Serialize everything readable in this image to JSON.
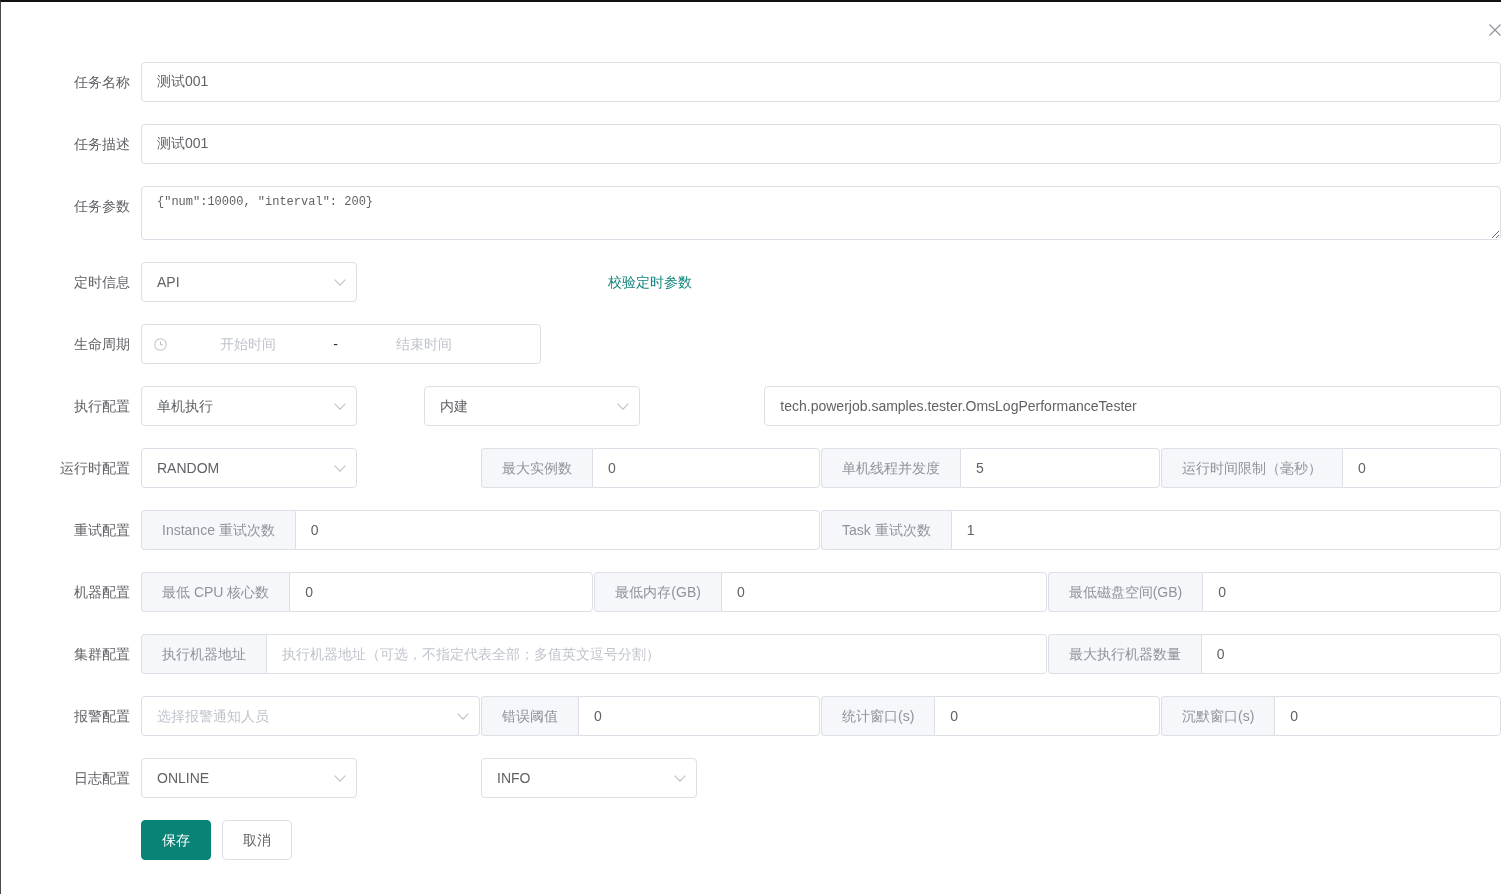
{
  "dialog": {
    "form": {
      "rows": [
        {
          "label": "任务名称",
          "controls": [
            {
              "kind": "input",
              "value": "测试001"
            }
          ]
        },
        {
          "label": "任务描述",
          "controls": [
            {
              "kind": "input",
              "value": "测试001"
            }
          ]
        },
        {
          "label": "任务参数",
          "controls": [
            {
              "kind": "textarea",
              "value": "{\"num\":10000, \"interval\": 200}"
            }
          ]
        },
        {
          "label": "定时信息",
          "controls": [
            {
              "kind": "select",
              "value": "API"
            },
            {
              "kind": "link",
              "text": "校验定时参数"
            }
          ]
        },
        {
          "label": "生命周期",
          "controls": [
            {
              "kind": "date_range",
              "start_placeholder": "开始时间",
              "separator": "-",
              "end_placeholder": "结束时间"
            }
          ]
        },
        {
          "label": "执行配置",
          "controls": [
            {
              "kind": "select",
              "value": "单机执行"
            },
            {
              "kind": "select",
              "value": "内建"
            },
            {
              "kind": "input",
              "value": "tech.powerjob.samples.tester.OmsLogPerformanceTester"
            }
          ]
        },
        {
          "label": "运行时配置",
          "controls": [
            {
              "kind": "select",
              "value": "RANDOM"
            },
            {
              "kind": "addon_input",
              "addon": "最大实例数",
              "value": "0"
            },
            {
              "kind": "addon_input",
              "addon": "单机线程并发度",
              "value": "5"
            },
            {
              "kind": "addon_input",
              "addon": "运行时间限制（毫秒）",
              "value": "0"
            }
          ]
        },
        {
          "label": "重试配置",
          "controls": [
            {
              "kind": "addon_input",
              "addon": "Instance 重试次数",
              "value": "0"
            },
            {
              "kind": "addon_input",
              "addon": "Task 重试次数",
              "value": "1"
            }
          ]
        },
        {
          "label": "机器配置",
          "controls": [
            {
              "kind": "addon_input",
              "addon": "最低 CPU 核心数",
              "value": "0"
            },
            {
              "kind": "addon_input",
              "addon": "最低内存(GB)",
              "value": "0"
            },
            {
              "kind": "addon_input",
              "addon": "最低磁盘空间(GB)",
              "value": "0"
            }
          ]
        },
        {
          "label": "集群配置",
          "controls": [
            {
              "kind": "addon_input",
              "addon": "执行机器地址",
              "placeholder": "执行机器地址（可选，不指定代表全部；多值英文逗号分割）"
            },
            {
              "kind": "addon_input",
              "addon": "最大执行机器数量",
              "value": "0"
            }
          ]
        },
        {
          "label": "报警配置",
          "controls": [
            {
              "kind": "select",
              "placeholder": "选择报警通知人员"
            },
            {
              "kind": "addon_input",
              "addon": "错误阈值",
              "value": "0"
            },
            {
              "kind": "addon_input",
              "addon": "统计窗口(s)",
              "value": "0"
            },
            {
              "kind": "addon_input",
              "addon": "沉默窗口(s)",
              "value": "0"
            }
          ]
        },
        {
          "label": "日志配置",
          "controls": [
            {
              "kind": "select",
              "value": "ONLINE"
            },
            {
              "kind": "select",
              "value": "INFO"
            }
          ]
        }
      ],
      "buttons": [
        {
          "kind": "primary",
          "label": "保存"
        },
        {
          "kind": "default",
          "label": "取消"
        }
      ]
    }
  }
}
